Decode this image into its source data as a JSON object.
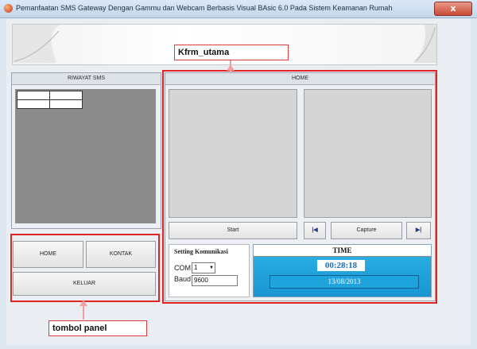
{
  "window": {
    "title": "Pemanfaatan SMS Gateway Dengan Gammu dan Webcam Berbasis Visual BAsic 6.0 Pada Sistem Keamanan Rumah",
    "close_label": "x"
  },
  "callouts": {
    "form_name": "Kfrm_utama",
    "panel_name": "tombol panel"
  },
  "riwayat": {
    "title": "RIWAYAT SMS"
  },
  "home": {
    "title": "HOME",
    "start_label": "Start",
    "capture_label": "Capture",
    "prev_label": "|◀",
    "next_label": "▶|"
  },
  "nav": {
    "home_label": "HOME",
    "kontak_label": "KONTAK",
    "keluar_label": "KELUAR"
  },
  "settings": {
    "title": "Setting Komunikasi",
    "com_label": "COM",
    "com_value": "1",
    "baud_label": "Baud",
    "baud_value": "9600"
  },
  "time": {
    "title": "TIME",
    "clock": "00:28:18",
    "date": "13/08/2013"
  },
  "colors": {
    "annotation_red": "#e02323",
    "time_panel_blue": "#1fa3dc"
  }
}
